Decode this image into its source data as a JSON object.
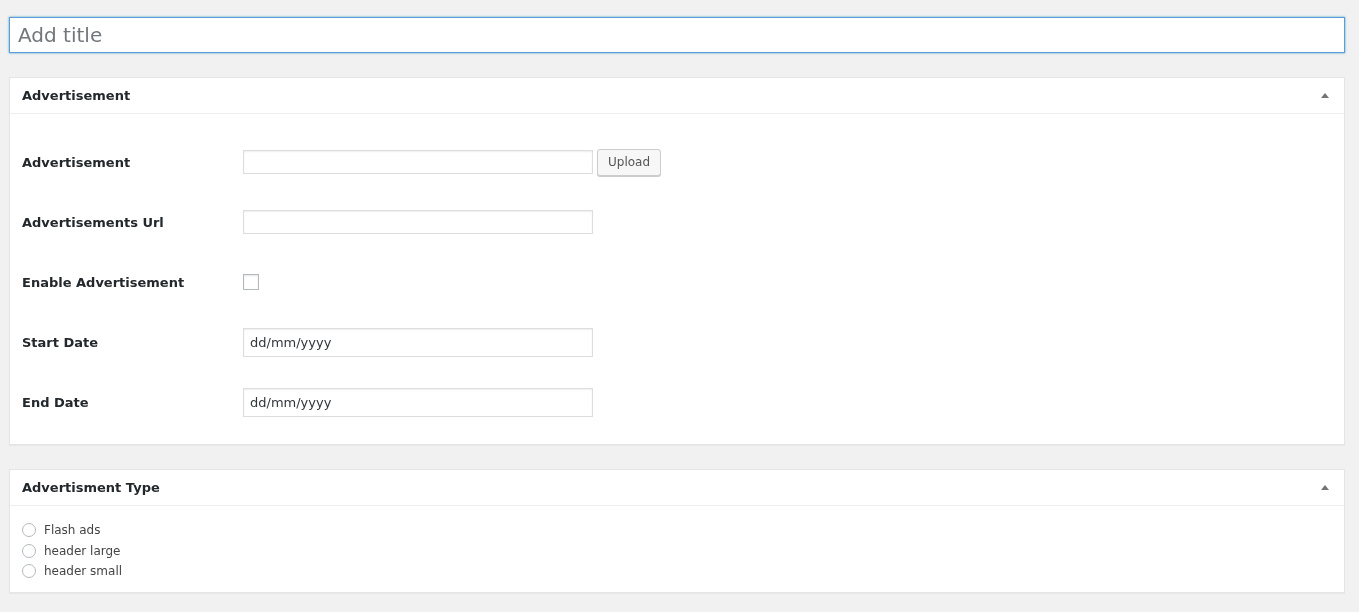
{
  "title_field": {
    "placeholder": "Add title"
  },
  "panels": [
    {
      "title": "Advertisement",
      "expanded": true,
      "fields": [
        {
          "kind": "upload",
          "label": "Advertisement",
          "button": "Upload"
        },
        {
          "kind": "text",
          "label": "Advertisements Url"
        },
        {
          "kind": "checkbox",
          "label": "Enable Advertisement",
          "checked": false
        },
        {
          "kind": "date",
          "label": "Start Date",
          "value": "dd/mm/yyyy"
        },
        {
          "kind": "date",
          "label": "End Date",
          "value": "dd/mm/yyyy"
        }
      ]
    },
    {
      "title": "Advertisment Type",
      "expanded": true,
      "options": [
        {
          "label": "Flash ads",
          "selected": false
        },
        {
          "label": "header large",
          "selected": false
        },
        {
          "label": "header small",
          "selected": false
        }
      ]
    }
  ]
}
